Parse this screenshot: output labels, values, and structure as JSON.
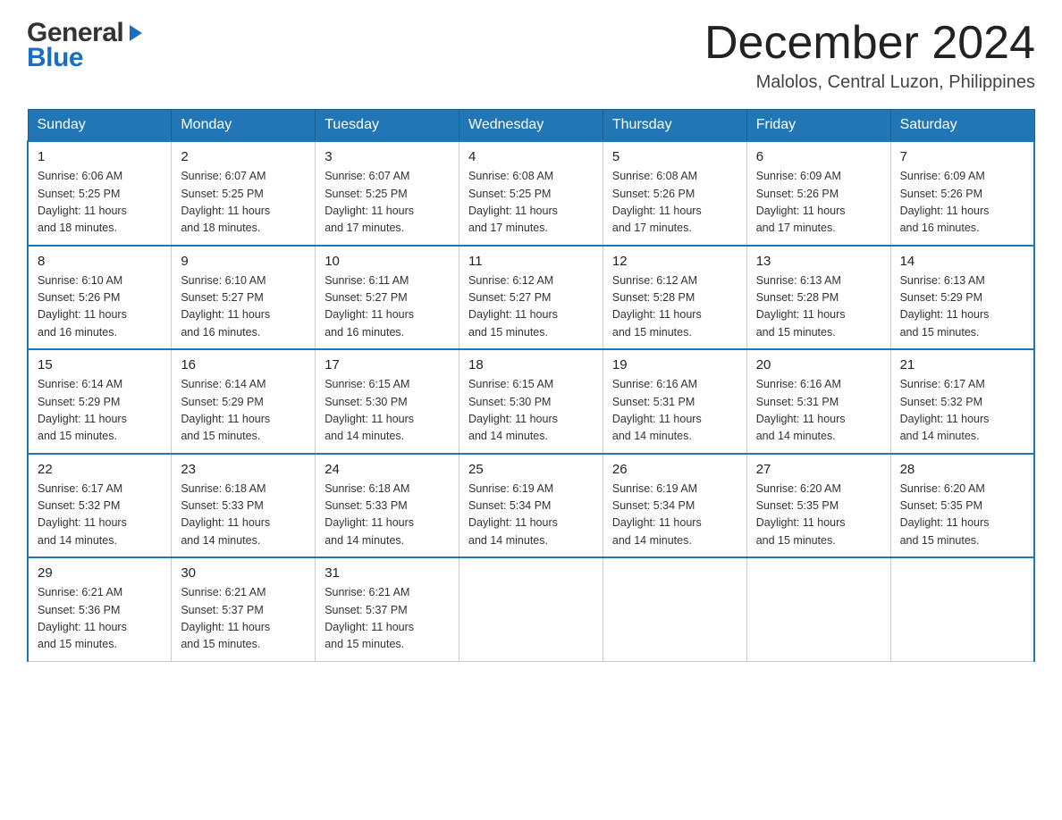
{
  "header": {
    "month_title": "December 2024",
    "location": "Malolos, Central Luzon, Philippines",
    "logo_general": "General",
    "logo_blue": "Blue"
  },
  "days_of_week": [
    "Sunday",
    "Monday",
    "Tuesday",
    "Wednesday",
    "Thursday",
    "Friday",
    "Saturday"
  ],
  "weeks": [
    [
      {
        "day": "1",
        "sunrise": "6:06 AM",
        "sunset": "5:25 PM",
        "daylight": "11 hours and 18 minutes."
      },
      {
        "day": "2",
        "sunrise": "6:07 AM",
        "sunset": "5:25 PM",
        "daylight": "11 hours and 18 minutes."
      },
      {
        "day": "3",
        "sunrise": "6:07 AM",
        "sunset": "5:25 PM",
        "daylight": "11 hours and 17 minutes."
      },
      {
        "day": "4",
        "sunrise": "6:08 AM",
        "sunset": "5:25 PM",
        "daylight": "11 hours and 17 minutes."
      },
      {
        "day": "5",
        "sunrise": "6:08 AM",
        "sunset": "5:26 PM",
        "daylight": "11 hours and 17 minutes."
      },
      {
        "day": "6",
        "sunrise": "6:09 AM",
        "sunset": "5:26 PM",
        "daylight": "11 hours and 17 minutes."
      },
      {
        "day": "7",
        "sunrise": "6:09 AM",
        "sunset": "5:26 PM",
        "daylight": "11 hours and 16 minutes."
      }
    ],
    [
      {
        "day": "8",
        "sunrise": "6:10 AM",
        "sunset": "5:26 PM",
        "daylight": "11 hours and 16 minutes."
      },
      {
        "day": "9",
        "sunrise": "6:10 AM",
        "sunset": "5:27 PM",
        "daylight": "11 hours and 16 minutes."
      },
      {
        "day": "10",
        "sunrise": "6:11 AM",
        "sunset": "5:27 PM",
        "daylight": "11 hours and 16 minutes."
      },
      {
        "day": "11",
        "sunrise": "6:12 AM",
        "sunset": "5:27 PM",
        "daylight": "11 hours and 15 minutes."
      },
      {
        "day": "12",
        "sunrise": "6:12 AM",
        "sunset": "5:28 PM",
        "daylight": "11 hours and 15 minutes."
      },
      {
        "day": "13",
        "sunrise": "6:13 AM",
        "sunset": "5:28 PM",
        "daylight": "11 hours and 15 minutes."
      },
      {
        "day": "14",
        "sunrise": "6:13 AM",
        "sunset": "5:29 PM",
        "daylight": "11 hours and 15 minutes."
      }
    ],
    [
      {
        "day": "15",
        "sunrise": "6:14 AM",
        "sunset": "5:29 PM",
        "daylight": "11 hours and 15 minutes."
      },
      {
        "day": "16",
        "sunrise": "6:14 AM",
        "sunset": "5:29 PM",
        "daylight": "11 hours and 15 minutes."
      },
      {
        "day": "17",
        "sunrise": "6:15 AM",
        "sunset": "5:30 PM",
        "daylight": "11 hours and 14 minutes."
      },
      {
        "day": "18",
        "sunrise": "6:15 AM",
        "sunset": "5:30 PM",
        "daylight": "11 hours and 14 minutes."
      },
      {
        "day": "19",
        "sunrise": "6:16 AM",
        "sunset": "5:31 PM",
        "daylight": "11 hours and 14 minutes."
      },
      {
        "day": "20",
        "sunrise": "6:16 AM",
        "sunset": "5:31 PM",
        "daylight": "11 hours and 14 minutes."
      },
      {
        "day": "21",
        "sunrise": "6:17 AM",
        "sunset": "5:32 PM",
        "daylight": "11 hours and 14 minutes."
      }
    ],
    [
      {
        "day": "22",
        "sunrise": "6:17 AM",
        "sunset": "5:32 PM",
        "daylight": "11 hours and 14 minutes."
      },
      {
        "day": "23",
        "sunrise": "6:18 AM",
        "sunset": "5:33 PM",
        "daylight": "11 hours and 14 minutes."
      },
      {
        "day": "24",
        "sunrise": "6:18 AM",
        "sunset": "5:33 PM",
        "daylight": "11 hours and 14 minutes."
      },
      {
        "day": "25",
        "sunrise": "6:19 AM",
        "sunset": "5:34 PM",
        "daylight": "11 hours and 14 minutes."
      },
      {
        "day": "26",
        "sunrise": "6:19 AM",
        "sunset": "5:34 PM",
        "daylight": "11 hours and 14 minutes."
      },
      {
        "day": "27",
        "sunrise": "6:20 AM",
        "sunset": "5:35 PM",
        "daylight": "11 hours and 15 minutes."
      },
      {
        "day": "28",
        "sunrise": "6:20 AM",
        "sunset": "5:35 PM",
        "daylight": "11 hours and 15 minutes."
      }
    ],
    [
      {
        "day": "29",
        "sunrise": "6:21 AM",
        "sunset": "5:36 PM",
        "daylight": "11 hours and 15 minutes."
      },
      {
        "day": "30",
        "sunrise": "6:21 AM",
        "sunset": "5:37 PM",
        "daylight": "11 hours and 15 minutes."
      },
      {
        "day": "31",
        "sunrise": "6:21 AM",
        "sunset": "5:37 PM",
        "daylight": "11 hours and 15 minutes."
      },
      null,
      null,
      null,
      null
    ]
  ],
  "cell_labels": {
    "sunrise_prefix": "Sunrise: ",
    "sunset_prefix": "Sunset: ",
    "daylight_prefix": "Daylight: "
  }
}
